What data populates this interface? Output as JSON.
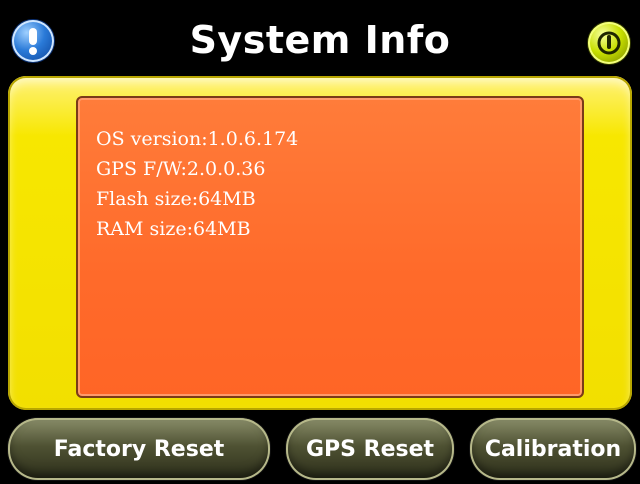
{
  "header": {
    "title": "System Info",
    "left_button_icon": "exclamation-icon",
    "right_button_icon": "power-icon"
  },
  "info": {
    "lines": [
      "OS version:1.0.6.174",
      "GPS F/W:2.0.0.36",
      "Flash size:64MB",
      "RAM size:64MB"
    ]
  },
  "buttons": {
    "factory_reset": "Factory Reset",
    "gps_reset": "GPS Reset",
    "calibration": "Calibration"
  },
  "colors": {
    "background": "#000000",
    "panel_yellow": "#f2df00",
    "info_orange": "#ff6a2a",
    "info_button_blue": "#2a7ad8",
    "power_button_yellow": "#c8e000"
  }
}
